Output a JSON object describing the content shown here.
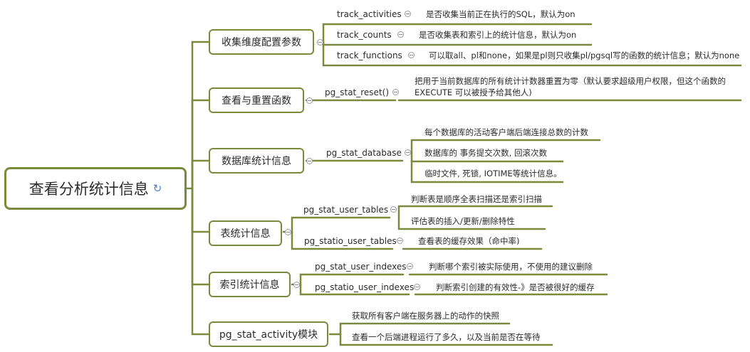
{
  "root": {
    "title": "查看分析统计信息",
    "link_icon": "link-icon"
  },
  "branches": [
    {
      "label": "收集维度配置参数",
      "items": [
        {
          "name": "track_activities",
          "desc": "是否收集当前正在执行的SQL，默认为on"
        },
        {
          "name": "track_counts",
          "desc": "是否收集表和索引上的统计信息，默认为on"
        },
        {
          "name": "track_functions",
          "desc": "可以取all、pl和none，如果是pl则只收集pl/pgsql写的函数的统计信息；默认为none"
        }
      ]
    },
    {
      "label": "查看与重置函数",
      "items": [
        {
          "name": "pg_stat_reset()",
          "desc_line1": "把用于当前数据库的所有统计计数器重置为零（默认要求超级用户权限，但这个函数的",
          "desc_line2": "EXECUTE 可以被授予给其他人)"
        }
      ]
    },
    {
      "label": "数据库统计信息",
      "items": [
        {
          "name": "pg_stat_database",
          "descs": [
            "每个数据库的活动客户端后端连接总数的计数",
            "数据库的 事务提交次数, 回滚次数",
            "临时文件, 死锁, IOTIME等统计信息。"
          ]
        }
      ]
    },
    {
      "label": "表统计信息",
      "items": [
        {
          "name": "pg_stat_user_tables",
          "descs": [
            "判断表是顺序全表扫描还是索引扫描",
            "评估表的插入/更新/删除特性"
          ]
        },
        {
          "name": "pg_statio_user_tables",
          "desc": "查看表的缓存效果（命中率)"
        }
      ]
    },
    {
      "label": "索引统计信息",
      "items": [
        {
          "name": "pg_stat_user_indexes",
          "desc": "判断哪个索引被实际使用，不使用的建议删除"
        },
        {
          "name": "pg_statio_user_indexes",
          "desc": "判断索引创建的有效性-》是否被很好的缓存"
        }
      ]
    },
    {
      "label": "pg_stat_activity模块",
      "items": [
        {
          "desc": "获取所有客户端在服务器上的动作的快照"
        },
        {
          "desc": "查看一个后端进程运行了多久，以及当前是否在等待"
        }
      ]
    }
  ],
  "fold_icon": "collapse-icon",
  "colors": {
    "branch": "#7a8a3c",
    "text": "#2b2b2b",
    "icon": "#4a7fd0"
  }
}
